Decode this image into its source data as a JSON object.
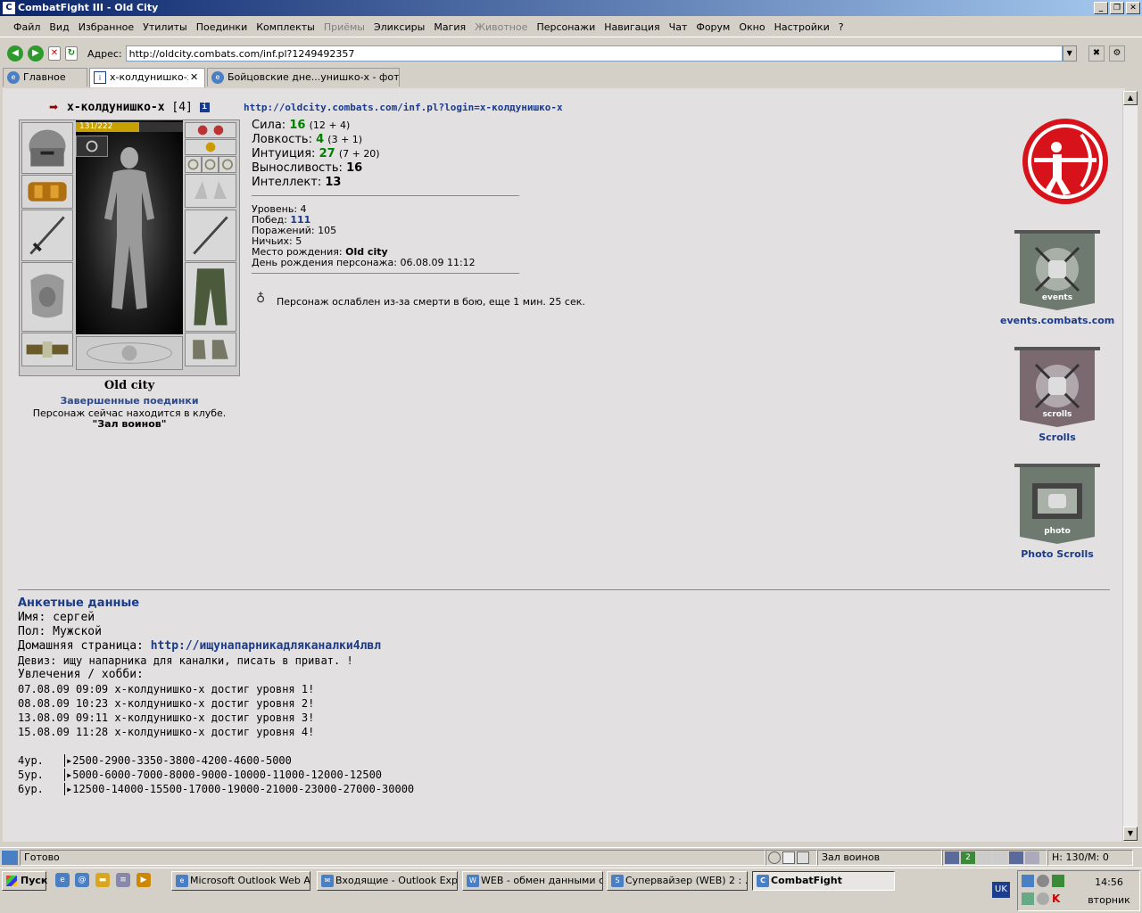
{
  "window": {
    "title": "CombatFight III - Old City",
    "app_icon": "combatfight-icon"
  },
  "menu": [
    "Файл",
    "Вид",
    "Избранное",
    "Утилиты",
    "Поединки",
    "Комплекты",
    "Приёмы",
    "Эликсиры",
    "Магия",
    "Животное",
    "Персонажи",
    "Навигация",
    "Чат",
    "Форум",
    "Окно",
    "Настройки",
    "?"
  ],
  "menu_disabled": [
    "Приёмы",
    "Животное"
  ],
  "address": {
    "label": "Адрес:",
    "value": "http://oldcity.combats.com/inf.pl?1249492357"
  },
  "tabs": [
    {
      "label": "Главное"
    },
    {
      "label": "x-колдунишко-х"
    },
    {
      "label": "Бойцовские дне...унишко-х - фот"
    }
  ],
  "character": {
    "name": "x-колдунишко-x",
    "level": "[4]",
    "hp": "131/222",
    "hp_fraction": 0.59,
    "city": "Old city",
    "fights_link": "Завершенные поединки",
    "location": "Персонаж сейчас находится в клубе.",
    "room": "\"Зал воинов\""
  },
  "inf_url": "http://oldcity.combats.com/inf.pl?login=x-колдунишко-x",
  "stats": [
    {
      "label": "Сила:",
      "value": "16",
      "detail": "(12 + 4)",
      "green": true
    },
    {
      "label": "Ловкость:",
      "value": "4",
      "detail": "(3 + 1)",
      "green": true
    },
    {
      "label": "Интуиция:",
      "value": "27",
      "detail": "(7 + 20)",
      "green": true
    },
    {
      "label": "Выносливость:",
      "value": "16",
      "detail": "",
      "green": false
    },
    {
      "label": "Интеллект:",
      "value": "13",
      "detail": "",
      "green": false
    }
  ],
  "record": {
    "level_label": "Уровень:",
    "level": "4",
    "wins_label": "Побед:",
    "wins": "111",
    "losses_label": "Поражений:",
    "losses": "105",
    "draws_label": "Ничьих:",
    "draws": "5",
    "birthplace_label": "Место рождения:",
    "birthplace": "Old city",
    "birthday_label": "День рождения персонажа:",
    "birthday": "06.08.09 11:12"
  },
  "weakness": "Персонаж ослаблен из-за смерти в бою, еще 1 мин. 25 сек.",
  "banners": [
    {
      "caption": "events.combats.com",
      "inner": "events"
    },
    {
      "caption": "Scrolls",
      "inner": "scrolls"
    },
    {
      "caption": "Photo Scrolls",
      "inner": "photo"
    }
  ],
  "anketa": {
    "heading": "Анкетные данные",
    "name_label": "Имя:",
    "name": "сергей",
    "sex_label": "Пол:",
    "sex": "Мужской",
    "home_label": "Домашняя страница:",
    "home": "http://ищунапарникадляканалки4лвл",
    "motto_label": "Девиз:",
    "motto": "ищу напарника для каналки, писать в приват. !",
    "hobby_label": "Увлечения / хобби:",
    "history": [
      "07.08.09 09:09 x-колдунишко-x достиг уровня 1!",
      "08.08.09 10:23 x-колдунишко-x достиг уровня 2!",
      "13.08.09 09:11 x-колдунишко-x достиг уровня 3!",
      "15.08.09 11:28 x-колдунишко-x достиг уровня 4!"
    ],
    "exp_table": [
      {
        "lvl": "4ур.",
        "values": "2500-2900-3350-3800-4200-4600-5000"
      },
      {
        "lvl": "5ур.",
        "values": "5000-6000-7000-8000-9000-10000-11000-12000-12500"
      },
      {
        "lvl": "6ур.",
        "values": "12500-14000-15500-17000-19000-21000-23000-27000-30000"
      }
    ]
  },
  "status": {
    "text": "Готово",
    "room": "Зал воинов",
    "counter": "Н: 130/М: 0"
  },
  "taskbar": {
    "start": "Пуск",
    "tasks": [
      "Microsoft Outlook Web A...",
      "Входящие - Outlook Exp...",
      "WEB - обмен данными с...",
      "Супервайзер (WEB) 2 : ...",
      "CombatFight"
    ],
    "lang": "UK",
    "time": "14:56",
    "day": "вторник"
  },
  "colors": {
    "link": "#1a3a8a",
    "green_stat": "#008000",
    "archer_red": "#d8121a",
    "banner_grey": "#6e7a70"
  }
}
